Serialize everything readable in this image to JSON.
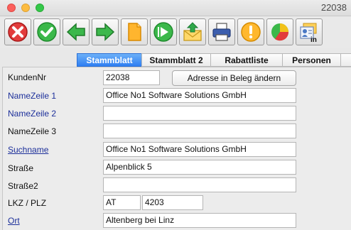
{
  "window": {
    "title": "22038"
  },
  "toolbar": {
    "icons": [
      "cancel-icon",
      "confirm-icon",
      "back-arrow-icon",
      "forward-arrow-icon",
      "document-icon",
      "play-icon",
      "mail-export-icon",
      "printer-icon",
      "warning-icon",
      "pie-chart-icon",
      "contact-card-in-icon"
    ],
    "card_badge": "in"
  },
  "tabs": [
    "Stammblatt",
    "Stammblatt 2",
    "Rabattliste",
    "Personen"
  ],
  "form": {
    "kundennr_label": "KundenNr",
    "kundennr_value": "22038",
    "adresse_button": "Adresse in Beleg ändern",
    "namezeile1_label": "NameZeile 1",
    "namezeile1_value": "Office No1 Software Solutions GmbH",
    "namezeile2_label": "NameZeile 2",
    "namezeile2_value": "",
    "namezeile3_label": "NameZeile 3",
    "namezeile3_value": "",
    "suchname_label": "Suchname",
    "suchname_value": "Office No1 Software Solutions GmbH",
    "strasse_label": "Straße",
    "strasse_value": "Alpenblick 5",
    "strasse2_label": "Straße2",
    "strasse2_value": "",
    "lkz_plz_label": "LKZ /  PLZ",
    "lkz_value": "AT",
    "plz_value": "4203",
    "ort_label": "Ort",
    "ort_value": "Altenberg bei Linz"
  },
  "colors": {
    "active_tab": "#2f7ff2",
    "link_label": "#1c2f9a"
  }
}
